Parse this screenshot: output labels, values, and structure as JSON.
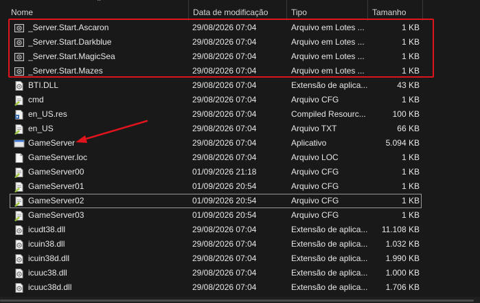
{
  "header": {
    "name": "Nome",
    "date": "Data de modificação",
    "type": "Tipo",
    "size": "Tamanho"
  },
  "files": [
    {
      "name": "_Server.Start.Ascaron",
      "date": "29/08/2026 07:04",
      "type": "Arquivo em Lotes ...",
      "size": "1 KB",
      "icon": "batch-file-icon"
    },
    {
      "name": "_Server.Start.Darkblue",
      "date": "29/08/2026 07:04",
      "type": "Arquivo em Lotes ...",
      "size": "1 KB",
      "icon": "batch-file-icon"
    },
    {
      "name": "_Server.Start.MagicSea",
      "date": "29/08/2026 07:04",
      "type": "Arquivo em Lotes ...",
      "size": "1 KB",
      "icon": "batch-file-icon"
    },
    {
      "name": "_Server.Start.Mazes",
      "date": "29/08/2026 07:04",
      "type": "Arquivo em Lotes ...",
      "size": "1 KB",
      "icon": "batch-file-icon"
    },
    {
      "name": "BTI.DLL",
      "date": "29/08/2026 07:04",
      "type": "Extensão de aplica...",
      "size": "43 KB",
      "icon": "dll-file-icon"
    },
    {
      "name": "cmd",
      "date": "29/08/2026 07:04",
      "type": "Arquivo CFG",
      "size": "1 KB",
      "icon": "cfg-file-icon"
    },
    {
      "name": "en_US.res",
      "date": "29/08/2026 07:04",
      "type": "Compiled Resourc...",
      "size": "100 KB",
      "icon": "res-file-icon"
    },
    {
      "name": "en_US",
      "date": "29/08/2026 07:04",
      "type": "Arquivo TXT",
      "size": "66 KB",
      "icon": "cfg-file-icon"
    },
    {
      "name": "GameServer",
      "date": "29/08/2026 07:04",
      "type": "Aplicativo",
      "size": "5.094 KB",
      "icon": "application-icon"
    },
    {
      "name": "GameServer.loc",
      "date": "29/08/2026 07:04",
      "type": "Arquivo LOC",
      "size": "1 KB",
      "icon": "blank-file-icon"
    },
    {
      "name": "GameServer00",
      "date": "01/09/2026 21:18",
      "type": "Arquivo CFG",
      "size": "1 KB",
      "icon": "cfg-file-icon"
    },
    {
      "name": "GameServer01",
      "date": "01/09/2026 20:54",
      "type": "Arquivo CFG",
      "size": "1 KB",
      "icon": "cfg-file-icon"
    },
    {
      "name": "GameServer02",
      "date": "01/09/2026 20:54",
      "type": "Arquivo CFG",
      "size": "1 KB",
      "icon": "cfg-file-icon"
    },
    {
      "name": "GameServer03",
      "date": "01/09/2026 20:54",
      "type": "Arquivo CFG",
      "size": "1 KB",
      "icon": "cfg-file-icon"
    },
    {
      "name": "icudt38.dll",
      "date": "29/08/2026 07:04",
      "type": "Extensão de aplica...",
      "size": "11.108 KB",
      "icon": "dll-file-icon"
    },
    {
      "name": "icuin38.dll",
      "date": "29/08/2026 07:04",
      "type": "Extensão de aplica...",
      "size": "1.032 KB",
      "icon": "dll-file-icon"
    },
    {
      "name": "icuin38d.dll",
      "date": "29/08/2026 07:04",
      "type": "Extensão de aplica...",
      "size": "1.990 KB",
      "icon": "dll-file-icon"
    },
    {
      "name": "icuuc38.dll",
      "date": "29/08/2026 07:04",
      "type": "Extensão de aplica...",
      "size": "1.000 KB",
      "icon": "dll-file-icon"
    },
    {
      "name": "icuuc38d.dll",
      "date": "29/08/2026 07:04",
      "type": "Extensão de aplica...",
      "size": "1.706 KB",
      "icon": "dll-file-icon"
    }
  ],
  "colors": {
    "background": "#191919",
    "highlight_box": "#e0141c",
    "arrow": "#e0141c",
    "text": "#e8e8e8"
  }
}
